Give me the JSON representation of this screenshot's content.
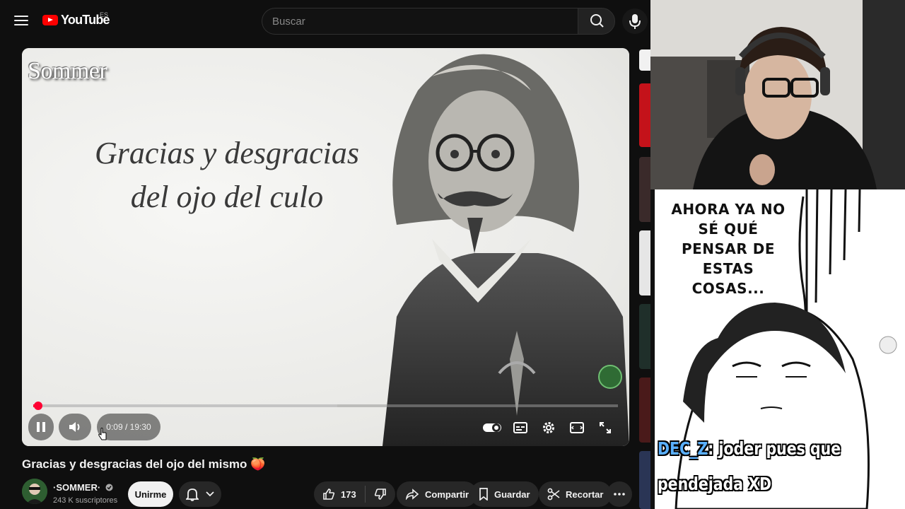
{
  "header": {
    "logo_text": "YouTube",
    "region": "ES",
    "search_placeholder": "Buscar"
  },
  "player": {
    "watermark": "Sommer",
    "slide_title_line1": "Gracias y desgracias",
    "slide_title_line2": "del ojo del culo",
    "current_time": "0:09",
    "duration": "19:30",
    "progress_fraction": 0.008,
    "buffered_fraction": 0.52,
    "accent": "#ff0033"
  },
  "overlay": {
    "speech_bubble": "AHORA YA NO SÉ QUÉ PENSAR DE ESTAS COSAS...",
    "chat_user": "DEC_Z",
    "chat_message_line1": ": joder pues que",
    "chat_message_line2": "pendejada XD"
  },
  "video": {
    "title": "Gracias y desgracias del ojo del mismo 🍑",
    "channel_name": "·SOMMER·",
    "subscribers": "243 K suscriptores",
    "join_label": "Unirme",
    "likes": "173",
    "share_label": "Compartir",
    "save_label": "Guardar",
    "clip_label": "Recortar"
  }
}
